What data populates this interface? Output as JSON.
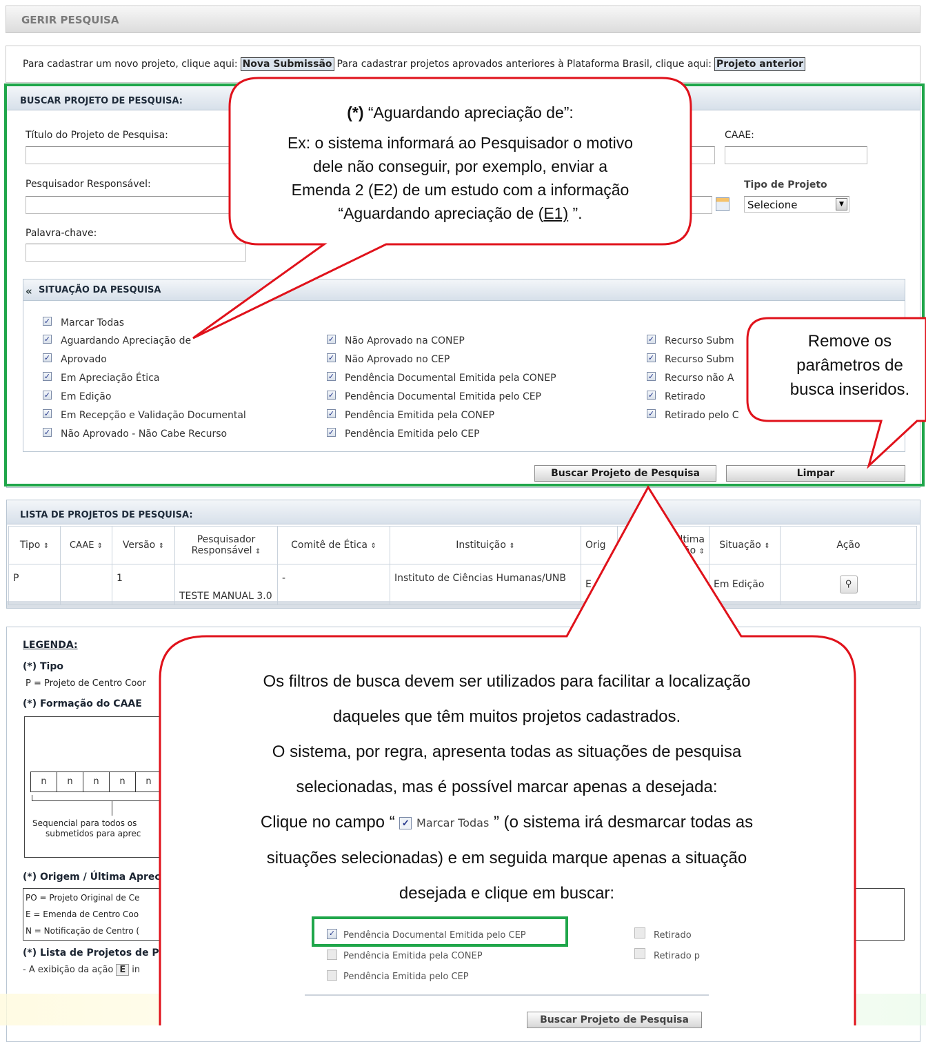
{
  "header": {
    "title": "GERIR PESQUISA"
  },
  "intro": {
    "new_text": "Para cadastrar um novo projeto, clique aqui:",
    "new_button": "Nova Submissão",
    "old_text": "Para cadastrar projetos aprovados anteriores à Plataforma Brasil, clique aqui:",
    "old_button": "Projeto anterior"
  },
  "search": {
    "section_title": "BUSCAR PROJETO DE PESQUISA:",
    "title_label": "Título do Projeto de Pesquisa:",
    "caae_label": "CAAE:",
    "researcher_label": "Pesquisador Responsável:",
    "tipo_label": "Tipo de Projeto",
    "tipo_value": "Selecione",
    "keyword_label": "Palavra-chave:",
    "situation_title": "SITUAÇÃO DA PESQUISA",
    "collapse_icon": "«",
    "mark_all": "Marcar Todas",
    "col1": [
      "Aguardando Apreciação de",
      "Aprovado",
      "Em Apreciação Ética",
      "Em Edição",
      "Em Recepção e Validação Documental",
      "Não Aprovado - Não Cabe Recurso"
    ],
    "col2": [
      "Não Aprovado na CONEP",
      "Não Aprovado no CEP",
      "Pendência Documental Emitida pela CONEP",
      "Pendência Documental Emitida pelo CEP",
      "Pendência Emitida pela CONEP",
      "Pendência Emitida pelo CEP"
    ],
    "col3": [
      "Recurso Subm",
      "Recurso Subm",
      "Recurso não A",
      "Retirado",
      "Retirado pelo C"
    ],
    "search_button": "Buscar Projeto de Pesquisa",
    "clear_button": "Limpar"
  },
  "list": {
    "section_title": "LISTA DE PROJETOS DE PESQUISA:",
    "sort_icon": "⇕",
    "headers": [
      "Tipo",
      "CAAE",
      "Versão",
      "Pesquisador Responsável",
      "Comitê de Ética",
      "Instituição",
      "Orig",
      "Última ciação",
      "Situação",
      "Ação"
    ],
    "header_researcher_l1": "Pesquisador",
    "header_researcher_l2": "Responsável",
    "header_last_l1": "Última",
    "header_last_l2": "iação",
    "row": {
      "tipo": "P",
      "caae": "",
      "versao": "1",
      "pesquisador": "TESTE MANUAL 3.0",
      "comite": "-",
      "instituicao": "Instituto de Ciências Humanas/UNB",
      "origem": "E",
      "situacao": "Em Edição"
    }
  },
  "legend": {
    "title": "LEGENDA:",
    "tipo_title": "(*) Tipo",
    "tipo_text": "P  =  Projeto de Centro Coor",
    "caae_title": "(*) Formação do CAAE",
    "caae_cells": [
      "n",
      "n",
      "n",
      "n",
      "n"
    ],
    "caae_seq_l1": "Sequencial para todos os",
    "caae_seq_l2": "submetidos para aprec",
    "origem_title": "(*) Origem / Última Aprec",
    "origem_items": [
      "PO = Projeto Original de Ce",
      "E = Emenda de Centro Coo",
      "N = Notificação de Centro ("
    ],
    "lista_title": "(*) Lista de Projetos de P",
    "lista_text_a": "- A exibição da ação",
    "lista_text_e": "E",
    "lista_text_b": "in"
  },
  "callouts": {
    "top_l0_bold": "(*)",
    "top_l0": "“Aguardando apreciação de”:",
    "top_l1": "Ex: o sistema informará ao Pesquisador o motivo",
    "top_l2": "dele não conseguir, por exemplo, enviar a",
    "top_l3": "Emenda 2 (E2) de um estudo com a informação",
    "top_l4a": "“Aguardando apreciação de (",
    "top_l4u": "E1)",
    "top_l4b": " ”.",
    "right_l1": "Remove os",
    "right_l2": "parâmetros de",
    "right_l3": "busca inseridos.",
    "bottom_l1": "Os filtros de busca devem ser utilizados para facilitar a localização",
    "bottom_l2": "daqueles que têm muitos projetos cadastrados.",
    "bottom_l3": "O sistema, por regra, apresenta todas as situações de pesquisa",
    "bottom_l4": "selecionadas, mas é possível marcar apenas a desejada:",
    "bottom_l5a": "Clique no campo “",
    "bottom_l5_mark": "Marcar Todas",
    "bottom_l5b": "” (o sistema irá desmarcar todas as",
    "bottom_l6": "situações selecionadas) e em seguida marque apenas a situação",
    "bottom_l7": "desejada e clique em buscar:",
    "ex_checked": "Pendência Documental Emitida pelo CEP",
    "ex_a": "Pendência Emitida pela CONEP",
    "ex_b": "Pendência Emitida pelo CEP",
    "ex_c": "Retirado",
    "ex_d": "Retirado p",
    "ex_button": "Buscar Projeto de Pesquisa"
  },
  "colors": {
    "highlight_green": "#1fa64a",
    "callout_red": "#e0121b"
  }
}
